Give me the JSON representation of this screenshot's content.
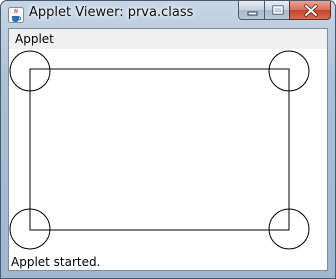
{
  "window": {
    "title": "Applet Viewer: prva.class",
    "icon": "java-coffee-icon"
  },
  "caption_buttons": {
    "minimize_icon": "minimize-icon",
    "maximize_icon": "maximize-icon",
    "close_icon": "close-icon"
  },
  "menu": {
    "items": [
      {
        "label": "Applet"
      }
    ]
  },
  "status": {
    "text": "Applet started."
  }
}
